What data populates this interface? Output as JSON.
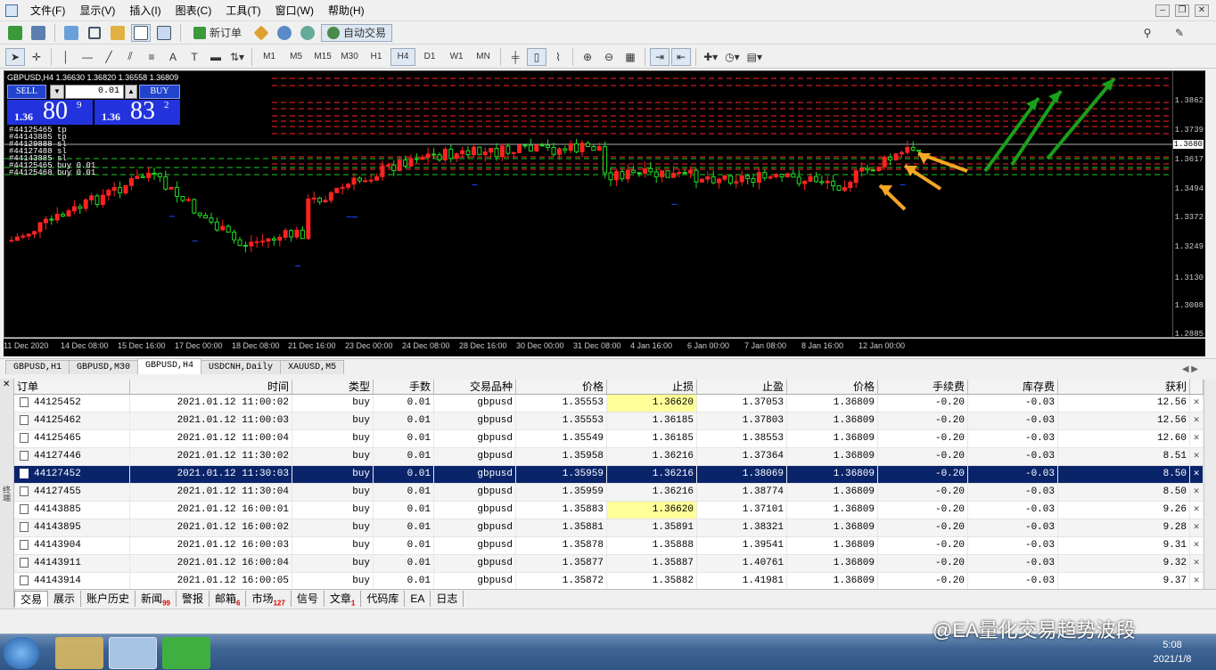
{
  "menubar": {
    "items": [
      "文件(F)",
      "显示(V)",
      "插入(I)",
      "图表(C)",
      "工具(T)",
      "窗口(W)",
      "帮助(H)"
    ]
  },
  "toolbar": {
    "new_order": "新订单",
    "auto_trading": "自动交易",
    "periods": [
      "M1",
      "M5",
      "M15",
      "M30",
      "H1",
      "H4",
      "D1",
      "W1",
      "MN"
    ],
    "active_period": "H4"
  },
  "chart": {
    "info": "GBPUSD,H4  1.36630 1.36820 1.36558 1.36809",
    "trade_panel": {
      "sell_label": "SELL",
      "buy_label": "BUY",
      "lot": "0.01",
      "sell_small": "1.36",
      "sell_big": "80",
      "sell_sup": "9",
      "buy_small": "1.36",
      "buy_big": "83",
      "buy_sup": "2"
    },
    "order_labels": [
      "#44125465 tp",
      "#44143885 tp",
      "#44129888 sl",
      "#44127488 sl",
      "#44143885 sl",
      "#44125465 buy 0.01",
      "#44125468 buy 0.01"
    ],
    "price_labels": [
      "1.3862",
      "1.3739",
      "1.3680",
      "1.3617",
      "1.3494",
      "1.3372",
      "1.3249",
      "1.3130",
      "1.3008",
      "1.2885"
    ],
    "current_price": "1.3680",
    "time_labels": [
      "11 Dec 2020",
      "14 Dec 08:00",
      "15 Dec 16:00",
      "17 Dec 00:00",
      "18 Dec 08:00",
      "21 Dec 16:00",
      "23 Dec 00:00",
      "24 Dec 08:00",
      "28 Dec 16:00",
      "30 Dec 00:00",
      "31 Dec 08:00",
      "4 Jan 16:00",
      "6 Jan 00:00",
      "7 Jan 08:00",
      "8 Jan 16:00",
      "12 Jan 00:00"
    ],
    "colors": {
      "bull": "#ff2222",
      "bear": "#22dd22",
      "sl_line": "#ff2222",
      "tp_line": "#22cc22",
      "arrow_green": "#1aa01a",
      "arrow_orange": "#f5a623"
    }
  },
  "chart_tabs": [
    "GBPUSD,H1",
    "GBPUSD,M30",
    "GBPUSD,H4",
    "USDCNH,Daily",
    "XAUUSD,M5"
  ],
  "active_chart_tab": "GBPUSD,H4",
  "terminal": {
    "side_label": "终端",
    "columns": [
      "订单",
      "时间",
      "类型",
      "手数",
      "交易品种",
      "价格",
      "止损",
      "止盈",
      "价格",
      "手续费",
      "库存费",
      "获利"
    ],
    "rows": [
      {
        "order": "44125452",
        "time": "2021.01.12 11:00:02",
        "type": "buy",
        "lots": "0.01",
        "symbol": "gbpusd",
        "price": "1.35553",
        "sl": "1.36620",
        "tp": "1.37053",
        "cur": "1.36809",
        "comm": "-0.20",
        "swap": "-0.03",
        "profit": "12.56",
        "sl_hl": true
      },
      {
        "order": "44125462",
        "time": "2021.01.12 11:00:03",
        "type": "buy",
        "lots": "0.01",
        "symbol": "gbpusd",
        "price": "1.35553",
        "sl": "1.36185",
        "tp": "1.37803",
        "cur": "1.36809",
        "comm": "-0.20",
        "swap": "-0.03",
        "profit": "12.56",
        "sl_hl": false
      },
      {
        "order": "44125465",
        "time": "2021.01.12 11:00:04",
        "type": "buy",
        "lots": "0.01",
        "symbol": "gbpusd",
        "price": "1.35549",
        "sl": "1.36185",
        "tp": "1.38553",
        "cur": "1.36809",
        "comm": "-0.20",
        "swap": "-0.03",
        "profit": "12.60",
        "sl_hl": false
      },
      {
        "order": "44127446",
        "time": "2021.01.12 11:30:02",
        "type": "buy",
        "lots": "0.01",
        "symbol": "gbpusd",
        "price": "1.35958",
        "sl": "1.36216",
        "tp": "1.37364",
        "cur": "1.36809",
        "comm": "-0.20",
        "swap": "-0.03",
        "profit": "8.51",
        "sl_hl": false
      },
      {
        "order": "44127452",
        "time": "2021.01.12 11:30:03",
        "type": "buy",
        "lots": "0.01",
        "symbol": "gbpusd",
        "price": "1.35959",
        "sl": "1.36216",
        "tp": "1.38069",
        "cur": "1.36809",
        "comm": "-0.20",
        "swap": "-0.03",
        "profit": "8.50",
        "sl_hl": false,
        "selected": true
      },
      {
        "order": "44127455",
        "time": "2021.01.12 11:30:04",
        "type": "buy",
        "lots": "0.01",
        "symbol": "gbpusd",
        "price": "1.35959",
        "sl": "1.36216",
        "tp": "1.38774",
        "cur": "1.36809",
        "comm": "-0.20",
        "swap": "-0.03",
        "profit": "8.50",
        "sl_hl": false
      },
      {
        "order": "44143885",
        "time": "2021.01.12 16:00:01",
        "type": "buy",
        "lots": "0.01",
        "symbol": "gbpusd",
        "price": "1.35883",
        "sl": "1.36620",
        "tp": "1.37101",
        "cur": "1.36809",
        "comm": "-0.20",
        "swap": "-0.03",
        "profit": "9.26",
        "sl_hl": true
      },
      {
        "order": "44143895",
        "time": "2021.01.12 16:00:02",
        "type": "buy",
        "lots": "0.01",
        "symbol": "gbpusd",
        "price": "1.35881",
        "sl": "1.35891",
        "tp": "1.38321",
        "cur": "1.36809",
        "comm": "-0.20",
        "swap": "-0.03",
        "profit": "9.28",
        "sl_hl": false
      },
      {
        "order": "44143904",
        "time": "2021.01.12 16:00:03",
        "type": "buy",
        "lots": "0.01",
        "symbol": "gbpusd",
        "price": "1.35878",
        "sl": "1.35888",
        "tp": "1.39541",
        "cur": "1.36809",
        "comm": "-0.20",
        "swap": "-0.03",
        "profit": "9.31",
        "sl_hl": false
      },
      {
        "order": "44143911",
        "time": "2021.01.12 16:00:04",
        "type": "buy",
        "lots": "0.01",
        "symbol": "gbpusd",
        "price": "1.35877",
        "sl": "1.35887",
        "tp": "1.40761",
        "cur": "1.36809",
        "comm": "-0.20",
        "swap": "-0.03",
        "profit": "9.32",
        "sl_hl": false
      },
      {
        "order": "44143914",
        "time": "2021.01.12 16:00:05",
        "type": "buy",
        "lots": "0.01",
        "symbol": "gbpusd",
        "price": "1.35872",
        "sl": "1.35882",
        "tp": "1.41981",
        "cur": "1.36809",
        "comm": "-0.20",
        "swap": "-0.03",
        "profit": "9.37",
        "sl_hl": false
      }
    ],
    "tabs": [
      {
        "label": "交易",
        "badge": ""
      },
      {
        "label": "展示",
        "badge": ""
      },
      {
        "label": "账户历史",
        "badge": ""
      },
      {
        "label": "新闻",
        "badge": "99"
      },
      {
        "label": "警报",
        "badge": ""
      },
      {
        "label": "邮箱",
        "badge": "6"
      },
      {
        "label": "市场",
        "badge": "127"
      },
      {
        "label": "信号",
        "badge": ""
      },
      {
        "label": "文章",
        "badge": "1"
      },
      {
        "label": "代码库",
        "badge": ""
      },
      {
        "label": "EA",
        "badge": ""
      },
      {
        "label": "日志",
        "badge": ""
      }
    ]
  },
  "taskbar": {
    "time": "5:08",
    "date": "2021/1/8"
  },
  "watermark": "@EA量化交易趋势波段"
}
